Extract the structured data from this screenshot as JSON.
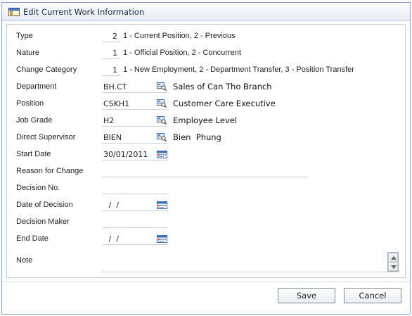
{
  "dialog": {
    "title": "Edit Current Work Information",
    "title_icon": "edit-window-icon"
  },
  "fields": {
    "type": {
      "label": "Type",
      "value": "2",
      "hint": "1 - Current Position, 2 - Previous"
    },
    "nature": {
      "label": "Nature",
      "value": "1",
      "hint": "1 - Official Position, 2 - Concurrent"
    },
    "change_category": {
      "label": "Change Category",
      "value": "1",
      "hint": "1 - New Employment, 2 - Department Transfer, 3 - Position Transfer"
    },
    "department": {
      "label": "Department",
      "value": "BH.CT",
      "description": "Sales of Can Tho Branch"
    },
    "position": {
      "label": "Position",
      "value": "CSKH1",
      "description": "Customer Care Executive"
    },
    "job_grade": {
      "label": "Job Grade",
      "value": "H2",
      "description": "Employee Level"
    },
    "direct_supervisor": {
      "label": "Direct Supervisor",
      "value": "BIEN",
      "description": "Bien  Phung"
    },
    "start_date": {
      "label": "Start Date",
      "value": "30/01/2011"
    },
    "reason_for_change": {
      "label": "Reason for Change",
      "value": ""
    },
    "decision_no": {
      "label": "Decision No.",
      "value": ""
    },
    "date_of_decision": {
      "label": "Date of Decision",
      "value": " /  /"
    },
    "decision_maker": {
      "label": "Decision Maker",
      "value": ""
    },
    "end_date": {
      "label": "End Date",
      "value": " /  /"
    },
    "note": {
      "label": "Note",
      "value": ""
    }
  },
  "buttons": {
    "save": "Save",
    "cancel": "Cancel"
  },
  "icons": {
    "lookup": "lookup-icon",
    "calendar": "calendar-icon",
    "scroll_up": "scroll-up-icon",
    "scroll_down": "scroll-down-icon"
  },
  "colors": {
    "border": "#8da2c4",
    "field_underline": "#c9d3e0",
    "title_bg_top": "#fdfdfe",
    "title_bg_bottom": "#e6ebf3"
  }
}
